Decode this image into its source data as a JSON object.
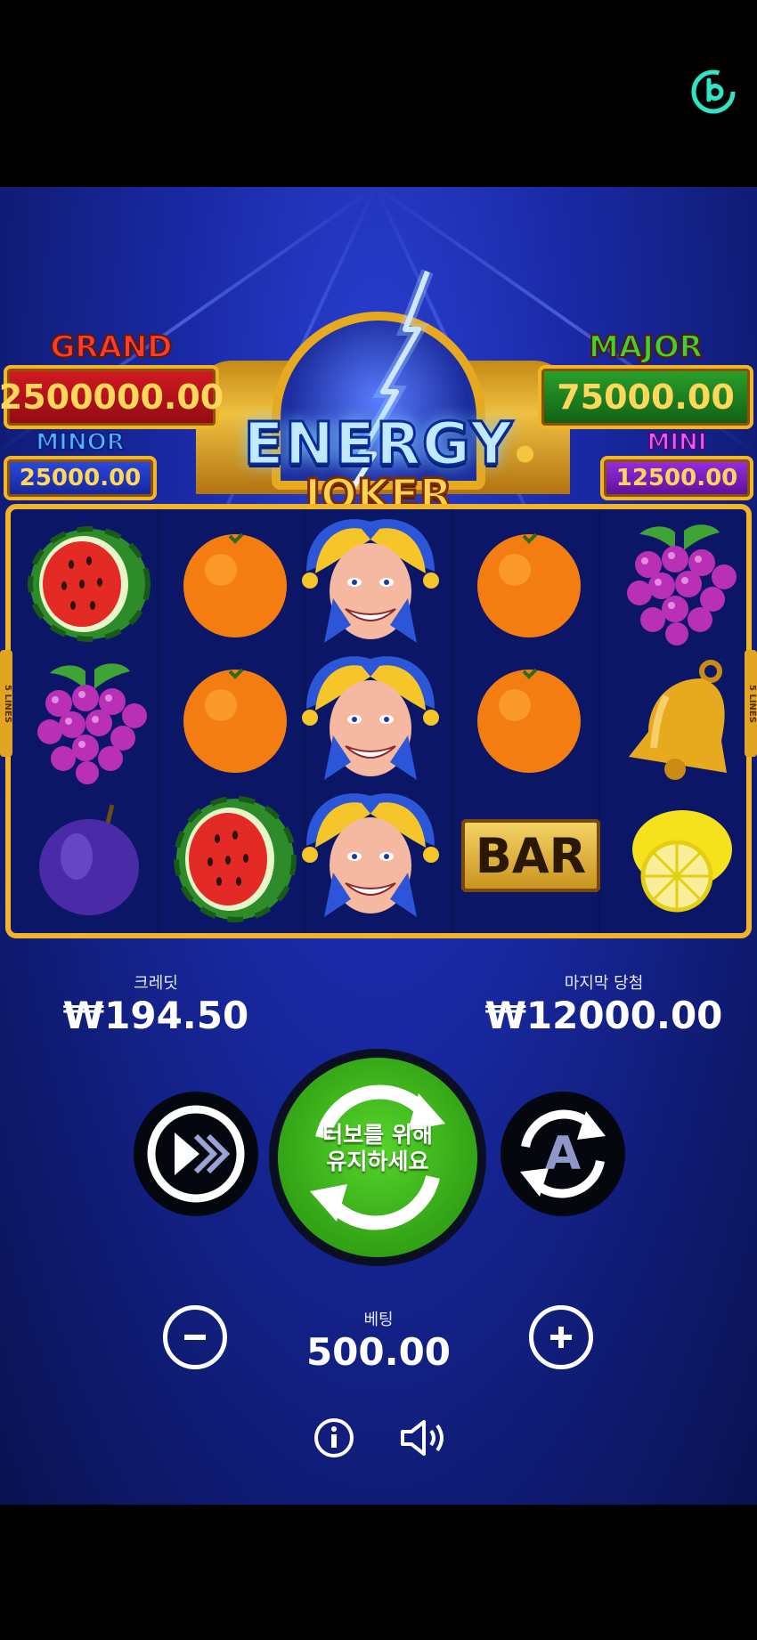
{
  "jackpots": {
    "grand": {
      "title": "GRAND",
      "value": "2500000.00"
    },
    "major": {
      "title": "MAJOR",
      "value": "75000.00"
    },
    "minor": {
      "title": "MINOR",
      "value": "25000.00"
    },
    "mini": {
      "title": "MINI",
      "value": "12500.00"
    }
  },
  "logo": {
    "line1": "ENERGY",
    "line2": "JOKER"
  },
  "reels": [
    [
      "watermelon",
      "grapes",
      "plum"
    ],
    [
      "orange",
      "orange",
      "watermelon"
    ],
    [
      "joker",
      "joker",
      "joker"
    ],
    [
      "orange",
      "orange",
      "bar"
    ],
    [
      "grapes",
      "bell",
      "lemon"
    ]
  ],
  "bar_symbol_text": "BAR",
  "lines_badge": {
    "count": "5",
    "word": "LINES"
  },
  "credit": {
    "label": "크레딧",
    "value": "₩194.50"
  },
  "last_win": {
    "label": "마지막 당첨",
    "value": "₩12000.00"
  },
  "spin_button": {
    "line1": "터보를 위해",
    "line2": "유지하세요"
  },
  "bet": {
    "label": "베팅",
    "value": "500.00"
  },
  "autoplay_letter": "A",
  "colors": {
    "grand_bg": "#c0121c",
    "major_bg": "#1f8a22",
    "minor_bg": "#1f37c0",
    "mini_bg": "#7d1fc4",
    "gold": "#f0b42a",
    "spin_green": "#3cae18"
  },
  "icons": [
    "brand-logo-icon",
    "turbo-icon",
    "autoplay-icon",
    "minus-icon",
    "plus-icon",
    "info-icon",
    "sound-icon"
  ]
}
